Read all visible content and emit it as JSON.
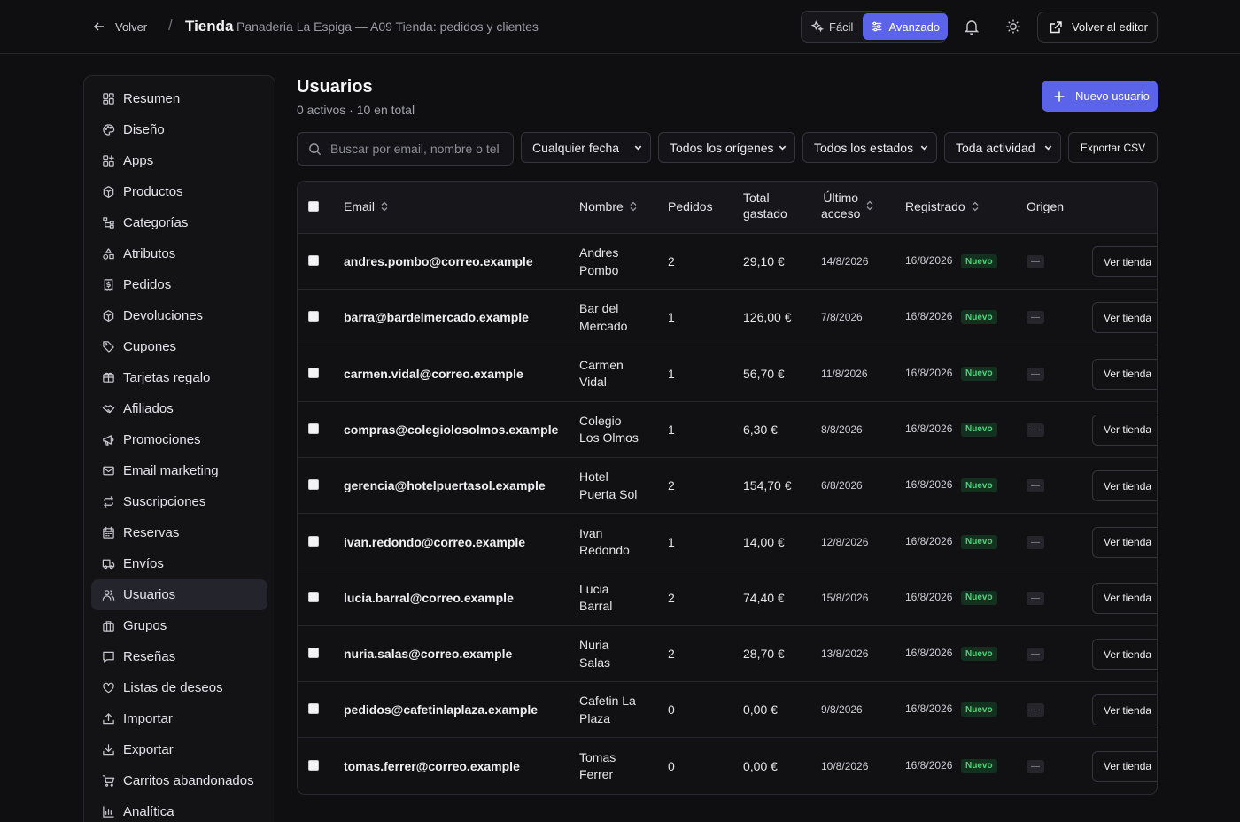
{
  "header": {
    "back_label": "Volver",
    "separator": "/",
    "title": "Tienda",
    "subtitle": "Panaderia La Espiga — A09 Tienda: pedidos y clientes",
    "mode_easy": "Fácil",
    "mode_advanced": "Avanzado",
    "editor_button": "Volver al editor"
  },
  "sidebar": {
    "items": [
      {
        "label": "Resumen",
        "icon": "grid-icon"
      },
      {
        "label": "Diseño",
        "icon": "palette-icon"
      },
      {
        "label": "Apps",
        "icon": "apps-icon"
      },
      {
        "label": "Productos",
        "icon": "box-icon"
      },
      {
        "label": "Categorías",
        "icon": "tree-icon"
      },
      {
        "label": "Atributos",
        "icon": "shapes-icon"
      },
      {
        "label": "Pedidos",
        "icon": "receipt-icon"
      },
      {
        "label": "Devoluciones",
        "icon": "box-return-icon"
      },
      {
        "label": "Cupones",
        "icon": "tag-icon"
      },
      {
        "label": "Tarjetas regalo",
        "icon": "card-icon"
      },
      {
        "label": "Afiliados",
        "icon": "handshake-icon"
      },
      {
        "label": "Promociones",
        "icon": "megaphone-icon"
      },
      {
        "label": "Email marketing",
        "icon": "mail-icon"
      },
      {
        "label": "Suscripciones",
        "icon": "repeat-icon"
      },
      {
        "label": "Reservas",
        "icon": "calendar-icon"
      },
      {
        "label": "Envíos",
        "icon": "truck-icon"
      },
      {
        "label": "Usuarios",
        "icon": "users-icon",
        "active": true
      },
      {
        "label": "Grupos",
        "icon": "group-icon"
      },
      {
        "label": "Reseñas",
        "icon": "message-icon"
      },
      {
        "label": "Listas de deseos",
        "icon": "heart-icon"
      },
      {
        "label": "Importar",
        "icon": "upload-icon"
      },
      {
        "label": "Exportar",
        "icon": "download-icon"
      },
      {
        "label": "Carritos abandonados",
        "icon": "cart-icon"
      },
      {
        "label": "Analítica",
        "icon": "bar-chart-icon"
      }
    ]
  },
  "main": {
    "title": "Usuarios",
    "subtitle": "0 activos · 10 en total",
    "new_button": "Nuevo usuario",
    "search_placeholder": "Buscar por email, nombre o tel",
    "filters": {
      "date": "Cualquier fecha",
      "origin": "Todos los orígenes",
      "status": "Todos los estados",
      "activity": "Toda actividad"
    },
    "export_button": "Exportar CSV"
  },
  "table": {
    "columns": {
      "email": "Email",
      "name": "Nombre",
      "orders": "Pedidos",
      "total_1": "Total",
      "total_2": "gastado",
      "last_1": "Último",
      "last_2": "acceso",
      "registered": "Registrado",
      "origin": "Origen"
    },
    "badge_label": "Nuevo",
    "origin_empty": "—",
    "action_label": "Ver tienda",
    "rows": [
      {
        "email": "andres.pombo@correo.example",
        "name1": "Andres",
        "name2": "Pombo",
        "orders": "2",
        "total": "29,10 €",
        "last": "14/8/2026",
        "registered": "16/8/2026"
      },
      {
        "email": "barra@bardelmercado.example",
        "name1": "Bar del",
        "name2": "Mercado",
        "orders": "1",
        "total": "126,00 €",
        "last": "7/8/2026",
        "registered": "16/8/2026"
      },
      {
        "email": "carmen.vidal@correo.example",
        "name1": "Carmen",
        "name2": "Vidal",
        "orders": "1",
        "total": "56,70 €",
        "last": "11/8/2026",
        "registered": "16/8/2026"
      },
      {
        "email": "compras@colegiolosolmos.example",
        "name1": "Colegio",
        "name2": "Los Olmos",
        "orders": "1",
        "total": "6,30 €",
        "last": "8/8/2026",
        "registered": "16/8/2026"
      },
      {
        "email": "gerencia@hotelpuertasol.example",
        "name1": "Hotel",
        "name2": "Puerta Sol",
        "orders": "2",
        "total": "154,70 €",
        "last": "6/8/2026",
        "registered": "16/8/2026"
      },
      {
        "email": "ivan.redondo@correo.example",
        "name1": "Ivan",
        "name2": "Redondo",
        "orders": "1",
        "total": "14,00 €",
        "last": "12/8/2026",
        "registered": "16/8/2026"
      },
      {
        "email": "lucia.barral@correo.example",
        "name1": "Lucia",
        "name2": "Barral",
        "orders": "2",
        "total": "74,40 €",
        "last": "15/8/2026",
        "registered": "16/8/2026"
      },
      {
        "email": "nuria.salas@correo.example",
        "name1": "Nuria",
        "name2": "Salas",
        "orders": "2",
        "total": "28,70 €",
        "last": "13/8/2026",
        "registered": "16/8/2026"
      },
      {
        "email": "pedidos@cafetinlaplaza.example",
        "name1": "Cafetin La",
        "name2": "Plaza",
        "orders": "0",
        "total": "0,00 €",
        "last": "9/8/2026",
        "registered": "16/8/2026"
      },
      {
        "email": "tomas.ferrer@correo.example",
        "name1": "Tomas",
        "name2": "Ferrer",
        "orders": "0",
        "total": "0,00 €",
        "last": "10/8/2026",
        "registered": "16/8/2026"
      }
    ]
  }
}
